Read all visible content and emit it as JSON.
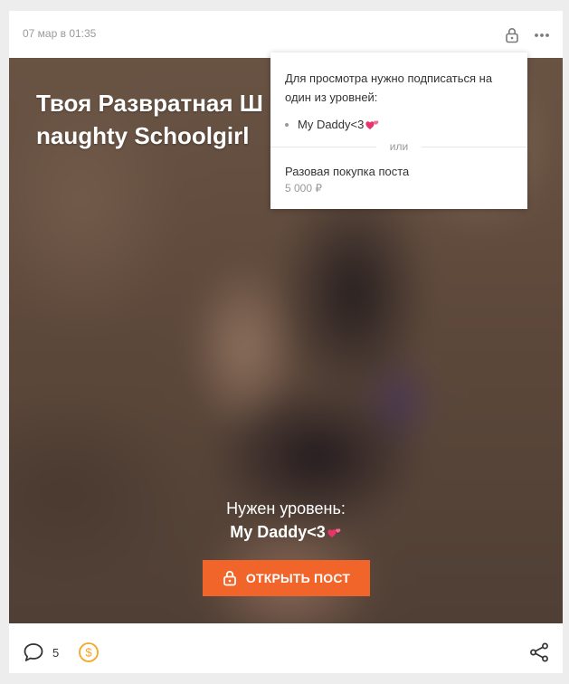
{
  "post": {
    "date": "07 мар в 01:35",
    "title_line1": "Твоя Развратная Ш",
    "title_line2": "naughty Schoolgirl"
  },
  "lock": {
    "need_level": "Нужен уровень:",
    "level_name": "My Daddy<3",
    "open_button": "ОТКРЫТЬ ПОСТ"
  },
  "popup": {
    "message": "Для просмотра нужно подписаться на один из уровней:",
    "levels": [
      {
        "label": "My Daddy<3"
      }
    ],
    "or_text": "или",
    "one_time_purchase": "Разовая покупка поста",
    "price": "5 000 ₽"
  },
  "footer": {
    "comments_count": "5"
  },
  "icons": {
    "lock": "lock-icon",
    "more": "more-dots-icon",
    "heart": "two-hearts-emoji",
    "comment": "comment-bubble-icon",
    "coin": "coin-donate-icon",
    "share": "share-icon"
  },
  "colors": {
    "accent": "#f2652a",
    "coin": "#f5a623",
    "heart": "#e8336b",
    "muted_text": "#9a9a9a"
  }
}
